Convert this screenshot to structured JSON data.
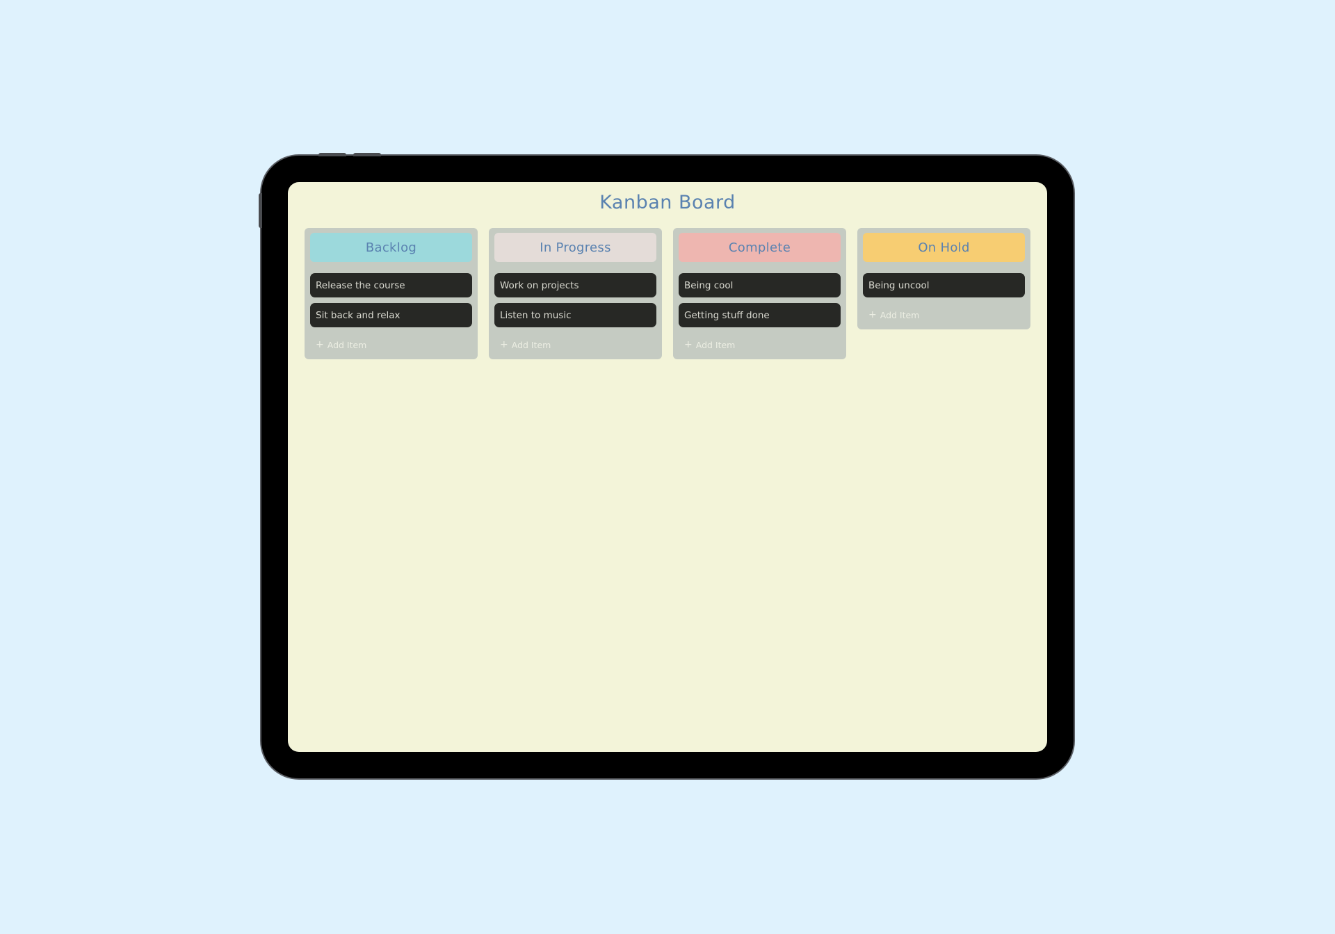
{
  "board": {
    "title": "Kanban Board",
    "columns": [
      {
        "name": "Backlog",
        "color": "#9cd9dc",
        "items": [
          "Release the course",
          "Sit back and relax"
        ],
        "add_label": "Add Item"
      },
      {
        "name": "In Progress",
        "color": "#e4dcd8",
        "items": [
          "Work on projects",
          "Listen to music"
        ],
        "add_label": "Add Item"
      },
      {
        "name": "Complete",
        "color": "#eeb6b0",
        "items": [
          "Being cool",
          "Getting stuff done"
        ],
        "add_label": "Add Item"
      },
      {
        "name": "On Hold",
        "color": "#f7cd72",
        "items": [
          "Being uncool"
        ],
        "add_label": "Add Item"
      }
    ]
  },
  "icons": {
    "add": "plus-icon"
  },
  "colors": {
    "page_background": "#dff2fd",
    "screen_background": "#f3f4d9",
    "column_background": "#c5cbc2",
    "card_background": "#272825",
    "title_color": "#5a82b0"
  }
}
